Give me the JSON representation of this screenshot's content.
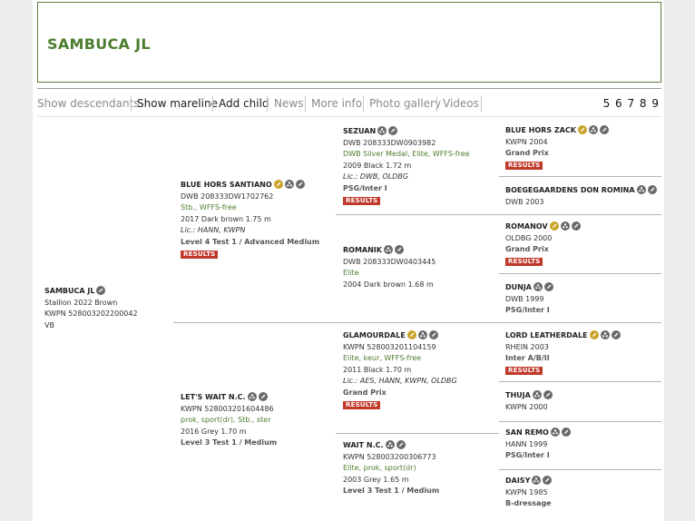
{
  "title": "SAMBUCA JL",
  "nav": {
    "show_descendants": "Show descendants",
    "show_mareline": "Show mareline",
    "add_child": "Add child",
    "news": "News",
    "more_info": "More info",
    "photo_gallery": "Photo gallery",
    "videos": "Videos",
    "generations": "5 6 7 8 9"
  },
  "results_label": "RESULTS",
  "colors": {
    "accent_green": "#4d7d2e",
    "results_red": "#c0392b",
    "icon_gold": "#c9a32a",
    "icon_gray": "#6a6a6a"
  },
  "horses": {
    "main": {
      "name": "SAMBUCA JL",
      "l1": "Stallion 2022 Brown",
      "l2": "KWPN 528003202200042",
      "l3": "VB"
    },
    "sire": {
      "name": "BLUE HORS SANTIANO",
      "l1": "DWB 208333DW1702762",
      "l2": "Stb., WFFS-free",
      "l3": "2017 Dark brown 1.75 m",
      "l4": "Lic.: HANN, KWPN",
      "l5": "Level 4 Test 1 / Advanced Medium"
    },
    "dam": {
      "name": "LET'S WAIT N.C.",
      "l1": "KWPN 528003201604486",
      "l2": "prok, sport(dr), Stb., ster",
      "l3": "2016 Grey 1.70 m",
      "l4": "Level 3 Test 1 / Medium"
    },
    "ss": {
      "name": "SEZUAN",
      "l1": "DWB 208333DW0903982",
      "l2": "DWB Silver Medal, Elite, WFFS-free",
      "l3": "2009 Black 1.72 m",
      "l4": "Lic.: DWB, OLDBG",
      "l5": "PSG/Inter I"
    },
    "sd": {
      "name": "ROMANIK",
      "l1": "DWB 208333DW0403445",
      "l2": "Elite",
      "l3": "2004 Dark brown 1.68 m"
    },
    "ds": {
      "name": "GLAMOURDALE",
      "l1": "KWPN 528003201104159",
      "l2": "Elite, keur, WFFS-free",
      "l3": "2011 Black 1.70 m",
      "l4": "Lic.: AES, HANN, KWPN, OLDBG",
      "l5": "Grand Prix"
    },
    "dd": {
      "name": "WAIT N.C.",
      "l1": "KWPN 528003200306773",
      "l2": "Elite, prok, sport(dr)",
      "l3": "2003 Grey 1.65 m",
      "l4": "Level 3 Test 1 / Medium"
    },
    "sss": {
      "name": "BLUE HORS ZACK",
      "l1": "KWPN 2004",
      "l2": "Grand Prix"
    },
    "ssd": {
      "name": "BOEGEGAARDENS DON ROMINA",
      "l1": "DWB 2003"
    },
    "sds": {
      "name": "ROMANOV",
      "l1": "OLDBG 2000",
      "l2": "Grand Prix"
    },
    "sdd": {
      "name": "DUNJA",
      "l1": "DWB 1999",
      "l2": "PSG/Inter I"
    },
    "dss": {
      "name": "LORD LEATHERDALE",
      "l1": "RHEIN 2003",
      "l2": "Inter A/B/II"
    },
    "dsd": {
      "name": "THUJA",
      "l1": "KWPN 2000"
    },
    "dds": {
      "name": "SAN REMO",
      "l1": "HANN 1999",
      "l2": "PSG/Inter I"
    },
    "ddd": {
      "name": "DAISY",
      "l1": "KWPN 1985",
      "l2": "B-dressage"
    }
  }
}
